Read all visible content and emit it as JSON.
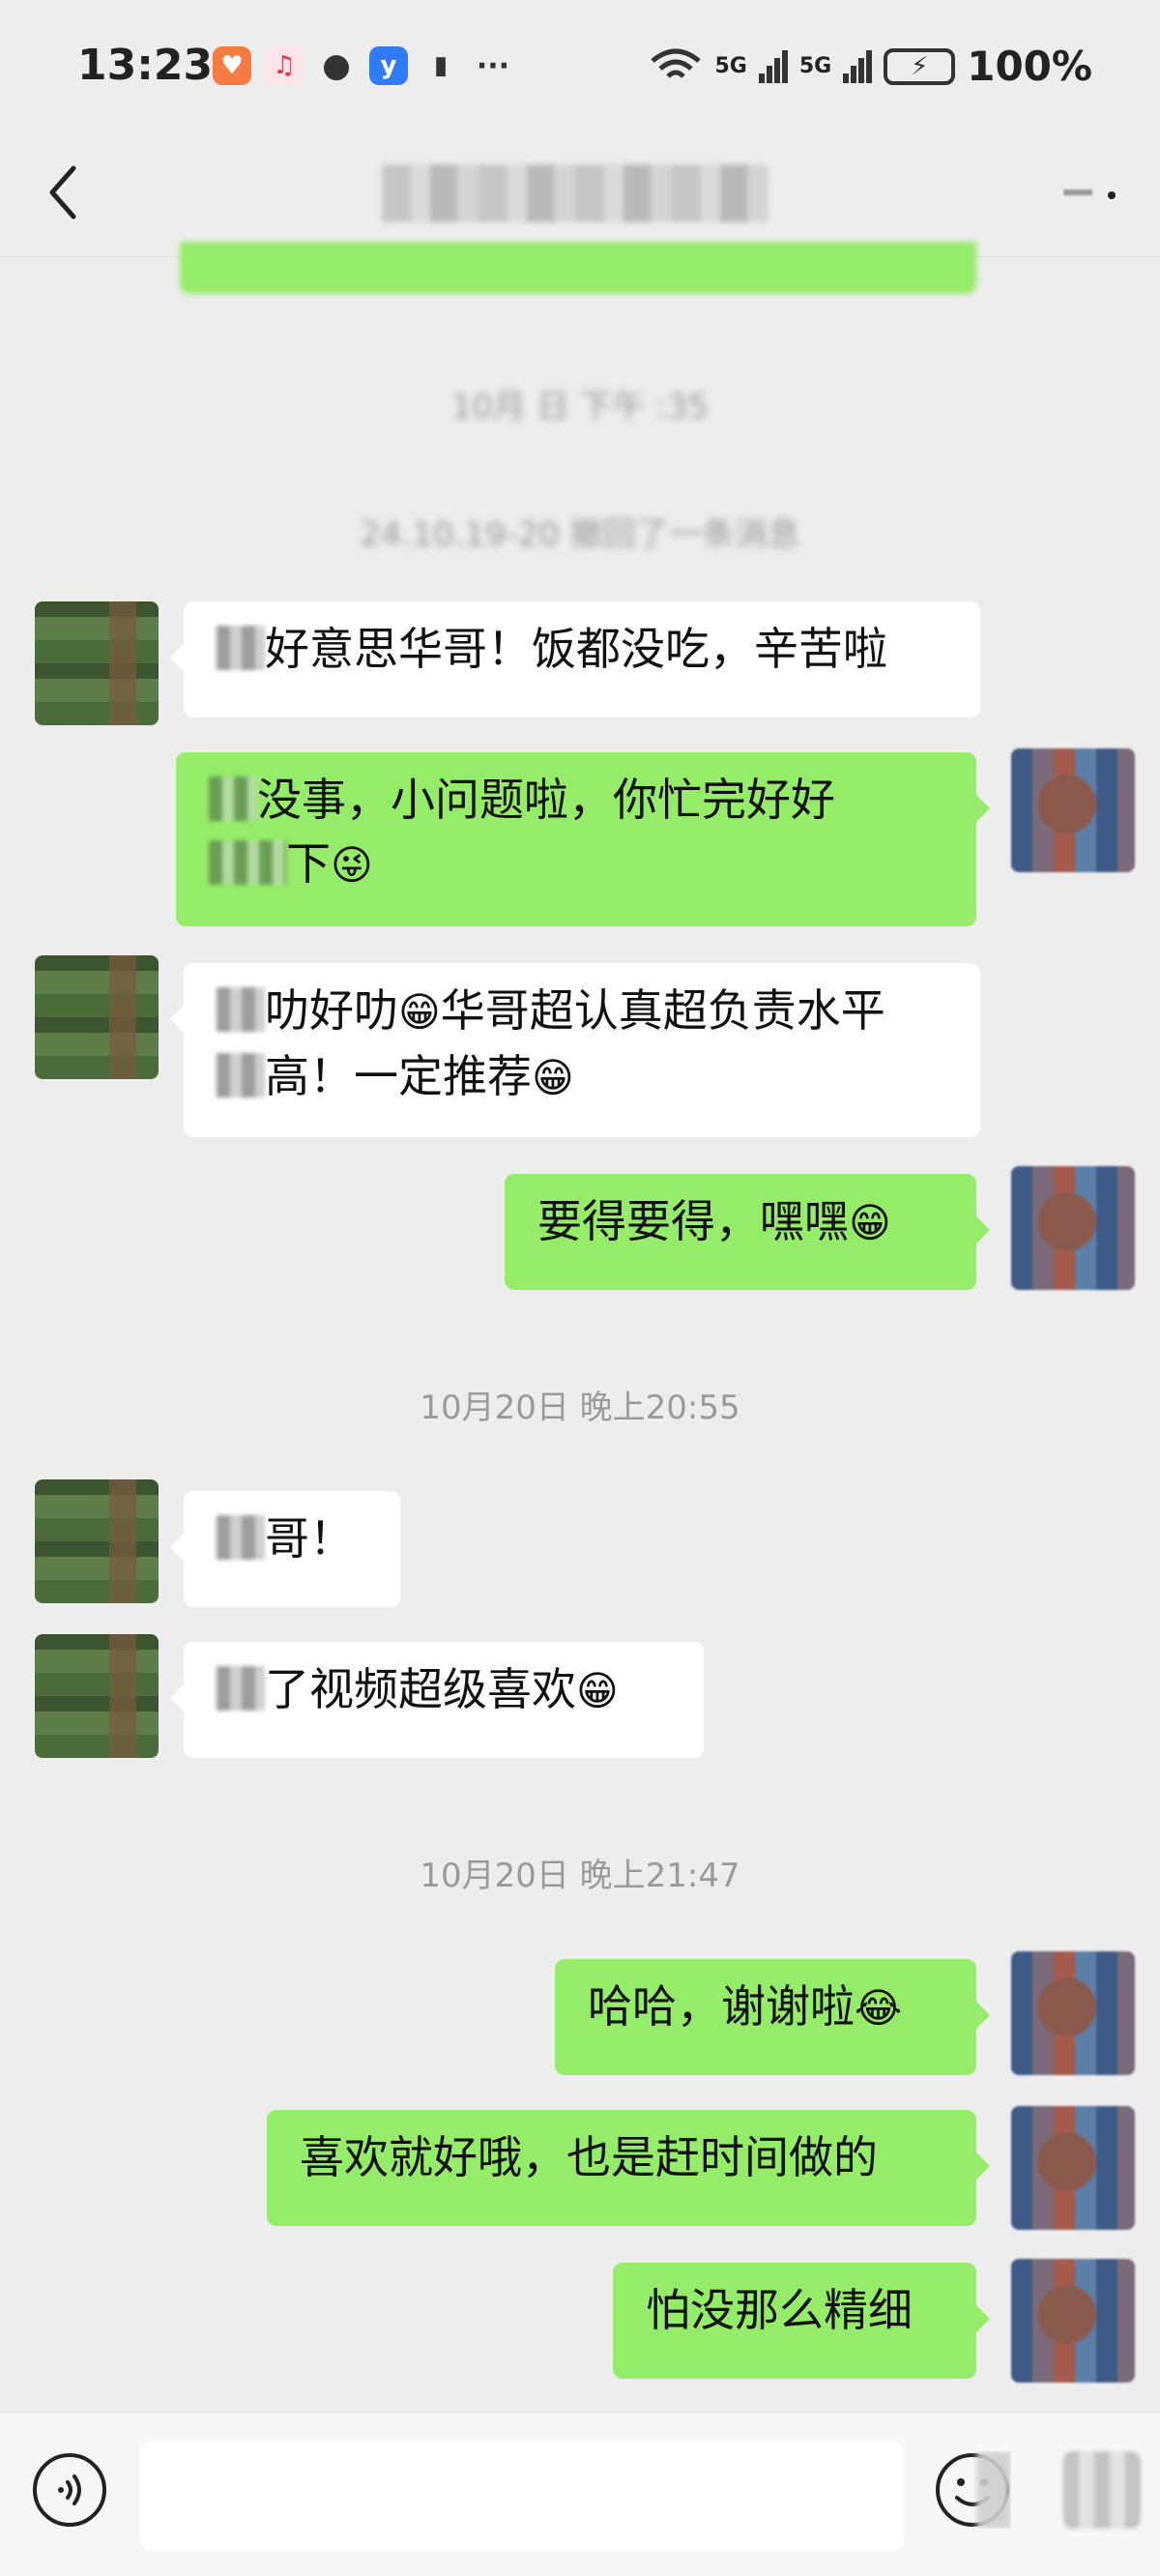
{
  "status_bar": {
    "time": "13:23",
    "signal_1": "5G",
    "signal_2": "5G",
    "battery": "100%",
    "more": "···"
  },
  "nav": {
    "back_icon": "chevron-left",
    "more_icon": "ellipsis"
  },
  "messages": {
    "ts1": "10月  日 下午  :35",
    "recall": "24.10.19-20  撤回了一条消息",
    "m1": "好意思华哥！饭都没吃，辛苦啦",
    "m2a": "没事，小问题啦，你忙完好好",
    "m2b": "下",
    "m3a": "叻好叻",
    "m3b": "华哥超认真超负责水平",
    "m3c": "高！一定推荐",
    "m4": "要得要得，嘿嘿",
    "ts2": "10月20日 晚上20:55",
    "m5": "哥！",
    "m6": "了视频超级喜欢",
    "ts3": "10月20日 晚上21:47",
    "m7": "哈哈，谢谢啦",
    "m8": "喜欢就好哦，也是赶时间做的",
    "m9": "怕没那么精细"
  },
  "emojis": {
    "wink_tongue": "😜",
    "grin": "😁",
    "tears_of_joy": "😂"
  },
  "input": {
    "value": ""
  },
  "colors": {
    "background": "#ededed",
    "bubble_self": "#95ec69",
    "bubble_other": "#ffffff",
    "timestamp": "#9a9a9a"
  }
}
